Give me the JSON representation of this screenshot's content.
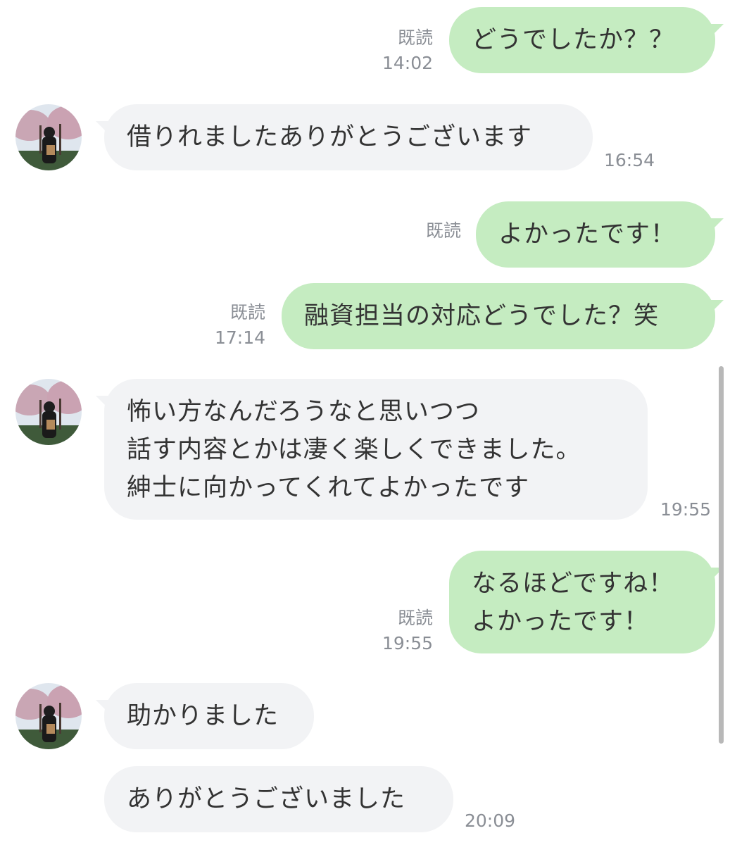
{
  "colors": {
    "incoming_bubble": "#f2f3f5",
    "outgoing_bubble": "#c5ecc1",
    "meta_text": "#8a8e95",
    "bubble_text": "#333333"
  },
  "avatar": {
    "icon": "avatar-photo-icon",
    "description_icon": "person-under-cherry-blossoms"
  },
  "messages": [
    {
      "side": "out",
      "lines": [
        "どうでしたか？？"
      ],
      "read": "既読",
      "time": "14:02"
    },
    {
      "side": "in",
      "lines": [
        "借りれましたありがとうございます"
      ],
      "time": "16:54"
    },
    {
      "side": "out",
      "lines": [
        "よかったです！"
      ],
      "read": "既読",
      "time": ""
    },
    {
      "side": "out",
      "lines": [
        "融資担当の対応どうでした？笑"
      ],
      "read": "既読",
      "time": "17:14"
    },
    {
      "side": "in",
      "lines": [
        "怖い方なんだろうなと思いつつ",
        "話す内容とかは凄く楽しくできました。",
        "紳士に向かってくれてよかったです"
      ],
      "time": "19:55"
    },
    {
      "side": "out",
      "lines": [
        "なるほどですね！",
        "よかったです！"
      ],
      "read": "既読",
      "time": "19:55"
    },
    {
      "side": "in",
      "lines": [
        "助かりました"
      ],
      "time": ""
    },
    {
      "side": "in",
      "lines": [
        "ありがとうございました"
      ],
      "time": "20:09"
    }
  ]
}
